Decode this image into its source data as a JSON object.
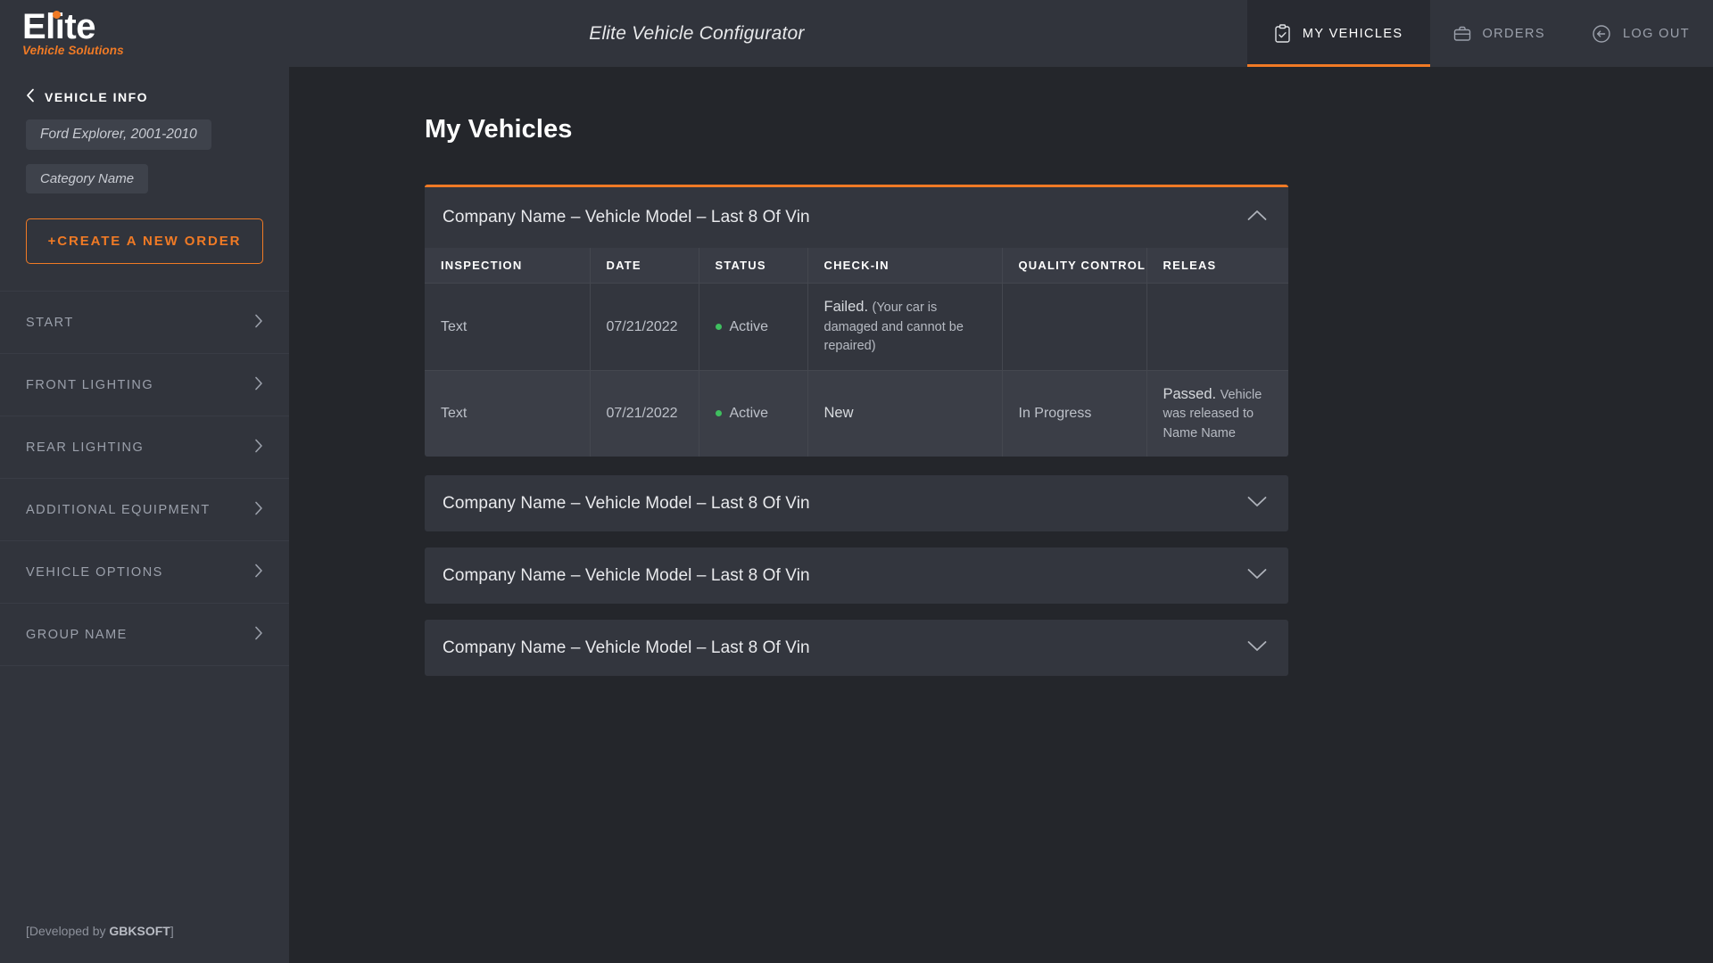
{
  "brand": {
    "logo_word": "Elite",
    "logo_sub": "Vehicle Solutions"
  },
  "header": {
    "app_title": "Elite Vehicle Configurator",
    "nav": [
      {
        "label": "MY VEHICLES",
        "icon": "clipboard-check-icon",
        "active": true
      },
      {
        "label": "ORDERS",
        "icon": "briefcase-icon",
        "active": false
      },
      {
        "label": "LOG OUT",
        "icon": "logout-circle-icon",
        "active": false
      }
    ]
  },
  "sidebar": {
    "vehicle_info_label": "VEHICLE INFO",
    "chips": [
      "Ford Explorer, 2001-2010",
      "Category Name"
    ],
    "create_order_label": "+CREATE A NEW ORDER",
    "items": [
      {
        "label": "START"
      },
      {
        "label": "FRONT LIGHTING"
      },
      {
        "label": "REAR LIGHTING"
      },
      {
        "label": "ADDITIONAL EQUIPMENT"
      },
      {
        "label": "VEHICLE OPTIONS"
      },
      {
        "label": "GROUP NAME"
      }
    ],
    "footer_prefix": "[Developed by ",
    "footer_brand": "GBKSOFT",
    "footer_suffix": "]"
  },
  "main": {
    "page_title": "My Vehicles",
    "cards": [
      {
        "title": "Company Name – Vehicle Model – Last 8 Of Vin",
        "expanded": true,
        "chevron": "chevron-up-icon"
      },
      {
        "title": "Company Name – Vehicle Model – Last 8 Of Vin",
        "expanded": false,
        "chevron": "chevron-down-icon"
      },
      {
        "title": "Company Name – Vehicle Model – Last 8 Of Vin",
        "expanded": false,
        "chevron": "chevron-down-icon"
      },
      {
        "title": "Company Name – Vehicle Model – Last 8 Of Vin",
        "expanded": false,
        "chevron": "chevron-down-icon"
      }
    ],
    "table": {
      "headers": [
        "INSPECTION",
        "DATE",
        "STATUS",
        "CHECK-IN",
        "QUALITY CONTROL",
        "RELEAS"
      ],
      "rows": [
        {
          "inspection": "Text",
          "date": "07/21/2022",
          "status": "Active",
          "status_color": "#3fbf5f",
          "checkin_lead": "Failed.",
          "checkin_sub": "(Your car is damaged and cannot be repaired)",
          "quality_control": "",
          "release_lead": "",
          "release_sub": ""
        },
        {
          "inspection": "Text",
          "date": "07/21/2022",
          "status": "Active",
          "status_color": "#3fbf5f",
          "checkin_lead": "New",
          "checkin_sub": "",
          "quality_control": "In Progress",
          "release_lead": "Passed.",
          "release_sub": "Vehicle was released to Name Name"
        }
      ]
    }
  },
  "colors": {
    "accent": "#f07a25",
    "panel": "#31343c",
    "canvas": "#24262b",
    "card": "#33363e",
    "status_active": "#3fbf5f"
  }
}
